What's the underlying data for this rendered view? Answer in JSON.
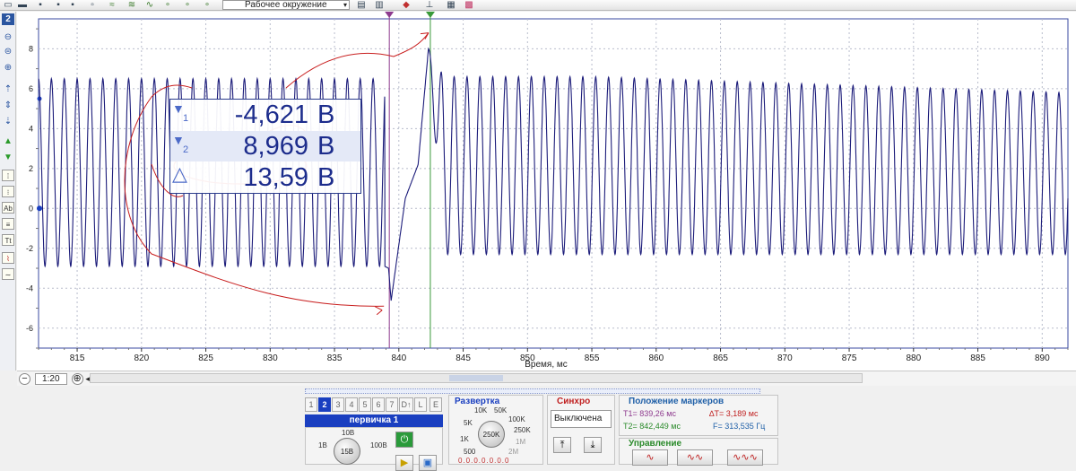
{
  "toolbar": {
    "environment_select": "Рабочее окружение",
    "icons": [
      "open-icon",
      "save-icon",
      "save-all-icon",
      "save-as-icon",
      "signal-icon",
      "signal-alt-icon",
      "signal-math-icon",
      "channel-0-icon",
      "channel-1-icon",
      "channel-2-icon",
      "environment-icon",
      "print-icon",
      "export-icon",
      "chip-icon",
      "table-icon",
      "grid-icon"
    ]
  },
  "left_tools": {
    "channel_number": "2",
    "buttons": [
      "zoom-out-icon",
      "zoom-reset-icon",
      "zoom-in-icon",
      "move-up-icon",
      "move-center-icon",
      "move-down-icon",
      "arrow-up-icon",
      "arrow-down-icon",
      "marker-1-icon",
      "marker-2-icon",
      "label-icon",
      "list-icon",
      "text-icon",
      "graph-icon",
      "wave-icon"
    ]
  },
  "chart_data": {
    "type": "line",
    "xlabel": "Время, мс",
    "xlim": [
      812,
      892
    ],
    "ylim": [
      -7,
      9.5
    ],
    "xticks": [
      "815",
      "820",
      "825",
      "830",
      "835",
      "840",
      "845",
      "850",
      "855",
      "860",
      "865",
      "870",
      "875",
      "880",
      "885",
      "890"
    ],
    "yticks": [
      "8",
      "6",
      "4",
      "2",
      "0",
      "-2",
      "-4",
      "-6"
    ],
    "grid": true,
    "series": [
      {
        "color": "#1c1c7a",
        "description_period_ms": 1.0,
        "x": [
          812,
          839.2,
          839.4,
          840.5,
          841.5,
          842.3,
          842.5,
          855,
          892
        ],
        "y": [
          6.5,
          -3.0,
          -4.62,
          0.5,
          2.2,
          8.0,
          8.97,
          6.6,
          5.8
        ],
        "baseline_low_before": -2.9,
        "baseline_high_before": 6.5,
        "baseline_low_after": -2.3,
        "baseline_high_after": 6.6
      }
    ],
    "markers": [
      {
        "id": "1",
        "time_ms": 839.26,
        "color": "#8e3a8e"
      },
      {
        "id": "2",
        "time_ms": 842.449,
        "color": "#3a9a3a"
      }
    ]
  },
  "readout": {
    "row1_index": "1",
    "row1_value": "-4,621",
    "row1_unit": "В",
    "row2_index": "2",
    "row2_value": "8,969",
    "row2_unit": "В",
    "row3_symbol": "△",
    "row3_value": "13,59",
    "row3_unit": "В"
  },
  "zoom": {
    "value": "1:20"
  },
  "channels": {
    "tabs": [
      "1",
      "2",
      "3",
      "4",
      "5",
      "6",
      "7",
      "D↑",
      "L",
      "E"
    ],
    "active_tab": "2",
    "name": "первичка 1",
    "volt_labels": [
      "10В",
      "1В",
      "100В",
      "15В"
    ]
  },
  "sweep": {
    "title": "Развертка",
    "labels": [
      "10K",
      "50K",
      "5K",
      "100K",
      "250K",
      "1K",
      "1M",
      "500",
      "2M"
    ],
    "knob_value": "250K",
    "counter": "0.0.0.0.0.0.0"
  },
  "trigger": {
    "title": "Синхро",
    "mode": "Выключена"
  },
  "markers_panel": {
    "title": "Положение маркеров",
    "t1": "T1= 839,26 мс",
    "dt": "∆T= 3,189 мс",
    "t2": "T2= 842,449 мс",
    "f": "F= 313,535 Гц",
    "control_title": "Управление"
  },
  "colors": {
    "trace": "#1c1c7a",
    "marker1": "#8e3a8e",
    "marker2": "#3a9a3a",
    "annotation": "#c81e1e",
    "readout_text": "#1c2c8c",
    "accent": "#1a3fc0"
  }
}
